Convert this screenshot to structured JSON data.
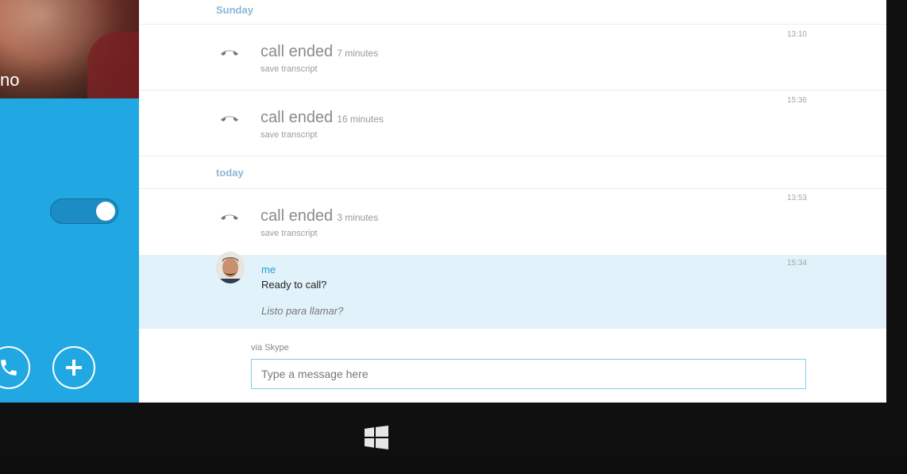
{
  "sidebar": {
    "contact_name": "no"
  },
  "history": [
    {
      "day": "Sunday",
      "call_label": "call ended",
      "duration": "7 minutes",
      "save": "save transcript",
      "time": "13:10"
    },
    {
      "call_label": "call ended",
      "duration": "16 minutes",
      "save": "save transcript",
      "time": "15:36"
    },
    {
      "day": "today",
      "call_label": "call ended",
      "duration": "3 minutes",
      "save": "save transcript",
      "time": "13:53"
    }
  ],
  "message": {
    "sender": "me",
    "text": "Ready to call?",
    "translation": "Listo para llamar?",
    "time": "15:34"
  },
  "composer": {
    "via": "via Skype",
    "placeholder": "Type a message here"
  },
  "colors": {
    "sidebar": "#21a8e3",
    "highlight_row": "#e1f2fb",
    "accent": "#1ea0d6"
  },
  "icons": [
    "phone-icon",
    "plus-icon",
    "hangup-icon",
    "windows-logo-icon"
  ]
}
